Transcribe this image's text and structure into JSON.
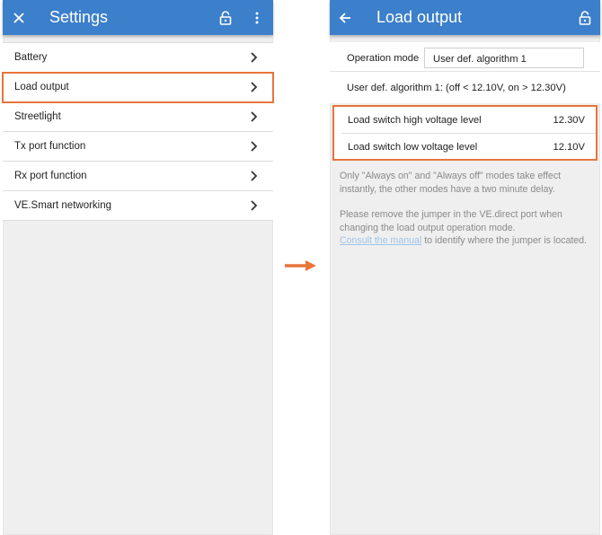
{
  "left": {
    "title": "Settings",
    "items": [
      {
        "label": "Battery"
      },
      {
        "label": "Load output"
      },
      {
        "label": "Streetlight"
      },
      {
        "label": "Tx port function"
      },
      {
        "label": "Rx port function"
      },
      {
        "label": "VE.Smart networking"
      }
    ],
    "icons": [
      "close-icon",
      "lock-icon",
      "more-vertical-icon",
      "chevron-right-icon"
    ]
  },
  "right": {
    "title": "Load output",
    "operation_mode_label": "Operation mode",
    "operation_mode_value": "User def. algorithm 1",
    "algorithm_description": "User def. algorithm 1: (off < 12.10V, on > 12.30V)",
    "high_label": "Load switch high voltage level",
    "high_value": "12.30V",
    "low_label": "Load switch low voltage level",
    "low_value": "12.10V",
    "note1": "Only \"Always on\" and \"Always off\" modes take effect instantly, the other modes have a two minute delay.",
    "note2": "Please remove the jumper in the VE.direct port when changing the load output operation mode.",
    "manual_link": "Consult the manual",
    "note3_suffix": " to identify where the jumper is located.",
    "icons": [
      "back-arrow-icon",
      "lock-icon"
    ]
  },
  "colors": {
    "appbar": "#3c7fca",
    "highlight": "#e8743b",
    "background": "#efefef",
    "link": "#9fc3ea"
  }
}
